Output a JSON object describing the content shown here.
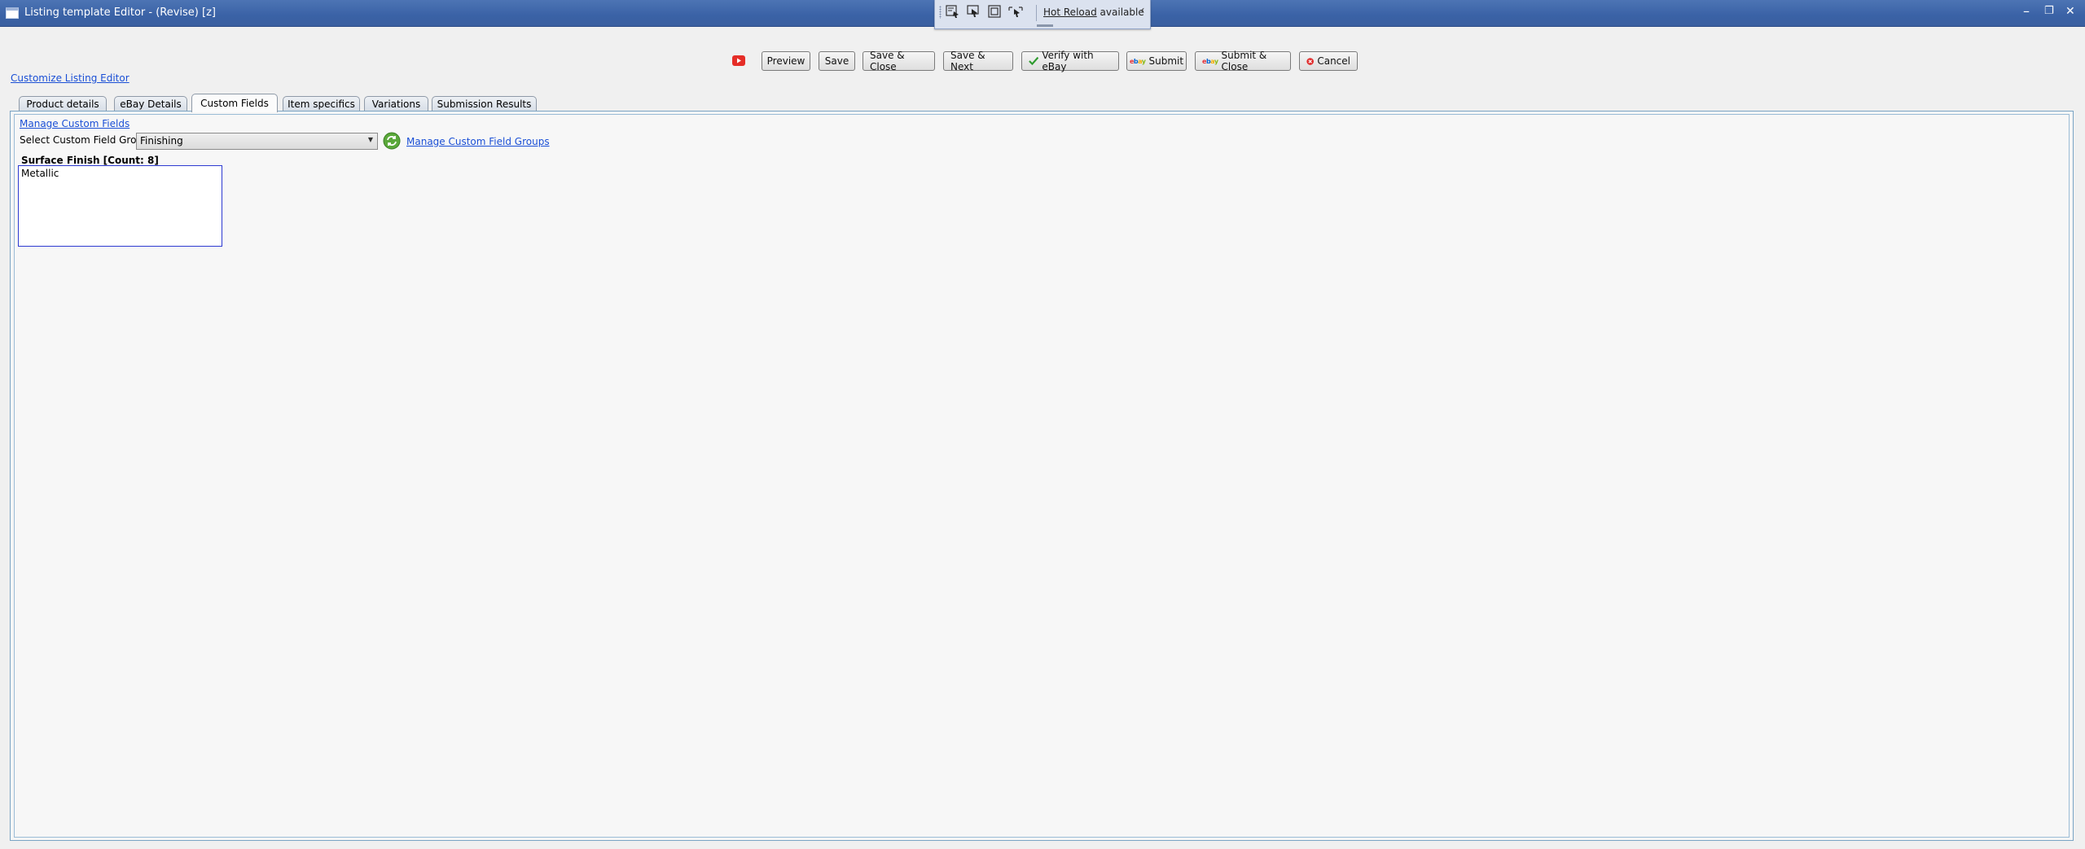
{
  "window": {
    "title": "Listing template Editor - (Revise) [z]",
    "controls": [
      "–",
      "❐",
      "✕"
    ]
  },
  "hot_reload": {
    "link": "Hot Reload",
    "status": "available"
  },
  "customize_link": "Customize Listing Editor",
  "toolbar": {
    "preview": "Preview",
    "save": "Save",
    "save_close": "Save & Close",
    "save_next": "Save & Next",
    "verify": "Verify with eBay",
    "submit": "Submit",
    "submit_close": "Submit & Close",
    "cancel": "Cancel"
  },
  "tabs": [
    {
      "label": "Product details",
      "active": false
    },
    {
      "label": "eBay Details",
      "active": false
    },
    {
      "label": "Custom Fields",
      "active": true
    },
    {
      "label": "Item specifics",
      "active": false
    },
    {
      "label": "Variations",
      "active": false
    },
    {
      "label": "Submission Results",
      "active": false
    }
  ],
  "custom_fields": {
    "manage_link": "Manage Custom Fields",
    "group_label": "Select Custom Field Group:",
    "group_value": "Finishing",
    "manage_groups_link": "Manage Custom Field Groups",
    "field_title": "Surface Finish  [Count: 8]",
    "field_value": "Metallic"
  },
  "colors": {
    "titlebar": "#3a62a6",
    "link": "#1a4fd6",
    "field_border": "#2d3ad1",
    "cancel_icon": "#e02b2b",
    "verify_icon": "#2e9b2e"
  }
}
